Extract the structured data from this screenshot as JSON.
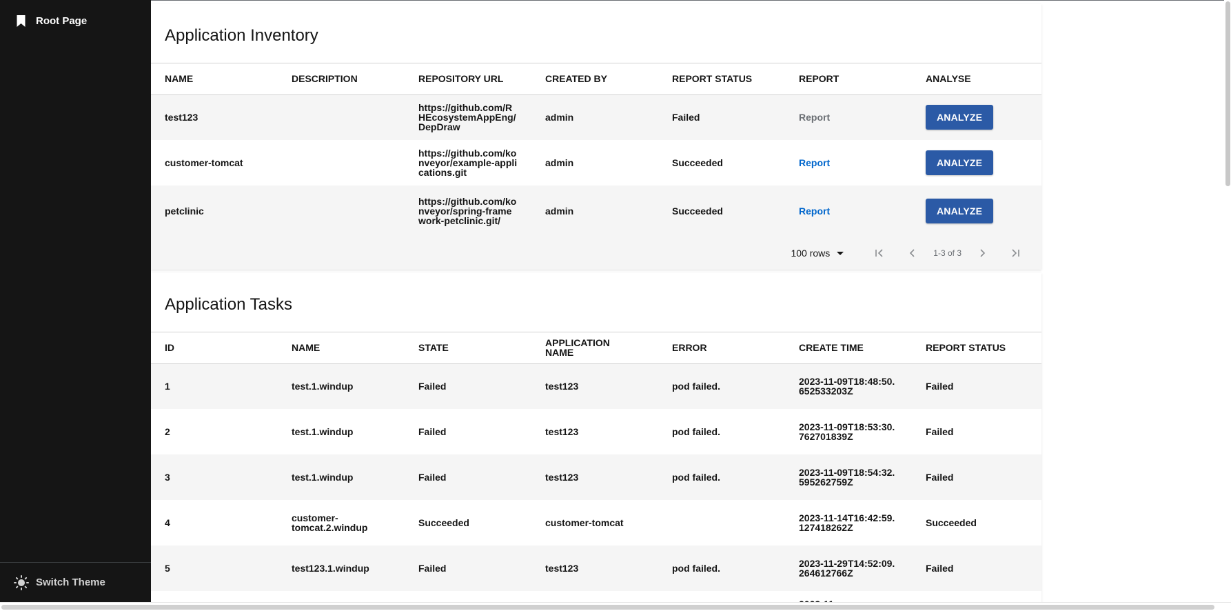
{
  "sidebar": {
    "nav_label": "Root Page",
    "switch_theme": "Switch Theme"
  },
  "inventory": {
    "title": "Application Inventory",
    "headers": [
      "NAME",
      "DESCRIPTION",
      "REPOSITORY URL",
      "CREATED BY",
      "REPORT STATUS",
      "REPORT",
      "ANALYSE"
    ],
    "rows": [
      {
        "name": "test123",
        "description": "",
        "url": "https://github.com/RHEcosystemAppEng/DepDraw",
        "created_by": "admin",
        "status": "Failed",
        "report": "Report",
        "report_enabled": false,
        "action": "ANALYZE"
      },
      {
        "name": "customer-tomcat",
        "description": "",
        "url": "https://github.com/konveyor/example-applications.git",
        "created_by": "admin",
        "status": "Succeeded",
        "report": "Report",
        "report_enabled": true,
        "action": "ANALYZE"
      },
      {
        "name": "petclinic",
        "description": "",
        "url": "https://github.com/konveyor/spring-framework-petclinic.git/",
        "created_by": "admin",
        "status": "Succeeded",
        "report": "Report",
        "report_enabled": true,
        "action": "ANALYZE"
      }
    ],
    "pagination": {
      "per_page": "100 rows",
      "range": "1-3 of 3"
    }
  },
  "tasks": {
    "title": "Application Tasks",
    "headers": [
      "ID",
      "NAME",
      "STATE",
      "APPLICATION NAME",
      "ERROR",
      "CREATE TIME",
      "REPORT STATUS"
    ],
    "rows": [
      {
        "id": "1",
        "name": "test.1.windup",
        "state": "Failed",
        "app": "test123",
        "error": "pod failed.",
        "time": "2023-11-09T18:48:50.652533203Z",
        "status": "Failed"
      },
      {
        "id": "2",
        "name": "test.1.windup",
        "state": "Failed",
        "app": "test123",
        "error": "pod failed.",
        "time": "2023-11-09T18:53:30.762701839Z",
        "status": "Failed"
      },
      {
        "id": "3",
        "name": "test.1.windup",
        "state": "Failed",
        "app": "test123",
        "error": "pod failed.",
        "time": "2023-11-09T18:54:32.595262759Z",
        "status": "Failed"
      },
      {
        "id": "4",
        "name": "customer-tomcat.2.windup",
        "state": "Succeeded",
        "app": "customer-tomcat",
        "error": "",
        "time": "2023-11-14T16:42:59.127418262Z",
        "status": "Succeeded"
      },
      {
        "id": "5",
        "name": "test123.1.windup",
        "state": "Failed",
        "app": "test123",
        "error": "pod failed.",
        "time": "2023-11-29T14:52:09.264612766Z",
        "status": "Failed"
      },
      {
        "id": "",
        "name": "",
        "state": "",
        "app": "",
        "error": "",
        "time": "2023-11-",
        "status": ""
      }
    ]
  }
}
